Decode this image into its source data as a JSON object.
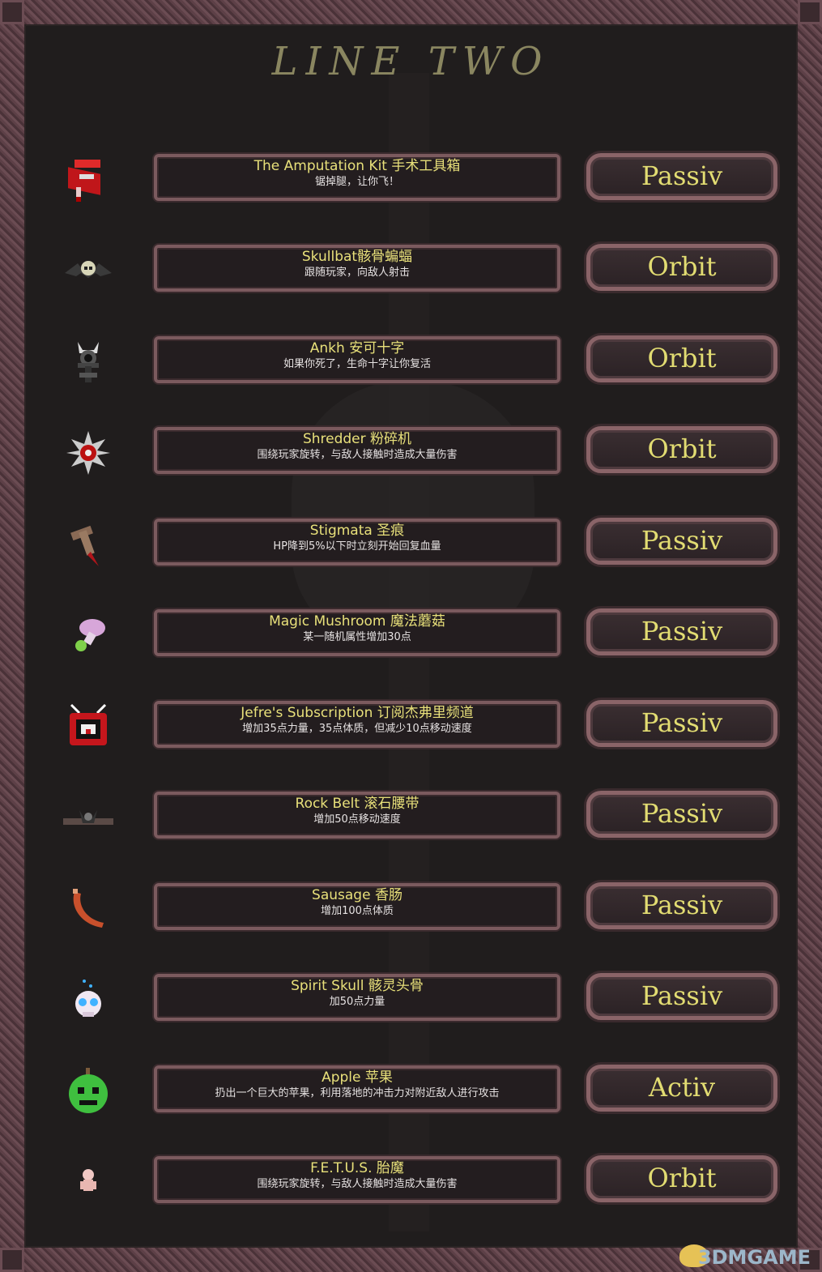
{
  "title": "LINE TWO",
  "items": [
    {
      "name": "The Amputation Kit 手术工具箱",
      "desc": "锯掉腿，让你飞！",
      "type": "Passiv",
      "icon": "red-toolbox-icon"
    },
    {
      "name": "Skullbat骸骨蝙蝠",
      "desc": "跟随玩家，向敌人射击",
      "type": "Orbit",
      "icon": "skull-bat-icon"
    },
    {
      "name": "Ankh 安可十字",
      "desc": "如果你死了，生命十字让你复活",
      "type": "Orbit",
      "icon": "horned-ankh-icon"
    },
    {
      "name": "Shredder 粉碎机",
      "desc": "围绕玩家旋转，与敌人接触时造成大量伤害",
      "type": "Orbit",
      "icon": "spiked-ball-icon"
    },
    {
      "name": "Stigmata 圣痕",
      "desc": "HP降到5%以下时立刻开始回复血量",
      "type": "Passiv",
      "icon": "stake-icon"
    },
    {
      "name": "Magic Mushroom 魔法蘑菇",
      "desc": "某一随机属性增加30点",
      "type": "Passiv",
      "icon": "mushroom-icon"
    },
    {
      "name": "Jefre's Subscription 订阅杰弗里频道",
      "desc": "增加35点力量，35点体质，但减少10点移动速度",
      "type": "Passiv",
      "icon": "tv-icon"
    },
    {
      "name": "Rock Belt 滚石腰带",
      "desc": "增加50点移动速度",
      "type": "Passiv",
      "icon": "rock-belt-icon"
    },
    {
      "name": "Sausage 香肠",
      "desc": "增加100点体质",
      "type": "Passiv",
      "icon": "sausage-icon"
    },
    {
      "name": "Spirit Skull 骸灵头骨",
      "desc": "加50点力量",
      "type": "Passiv",
      "icon": "spirit-skull-icon"
    },
    {
      "name": "Apple 苹果",
      "desc": "扔出一个巨大的苹果，利用落地的冲击力对附近敌人进行攻击",
      "type": "Activ",
      "icon": "apple-icon"
    },
    {
      "name": "F.E.T.U.S. 胎魔",
      "desc": "围绕玩家旋转，与敌人接触时造成大量伤害",
      "type": "Orbit",
      "icon": "fetus-icon"
    }
  ],
  "watermark": "3DMGAME"
}
